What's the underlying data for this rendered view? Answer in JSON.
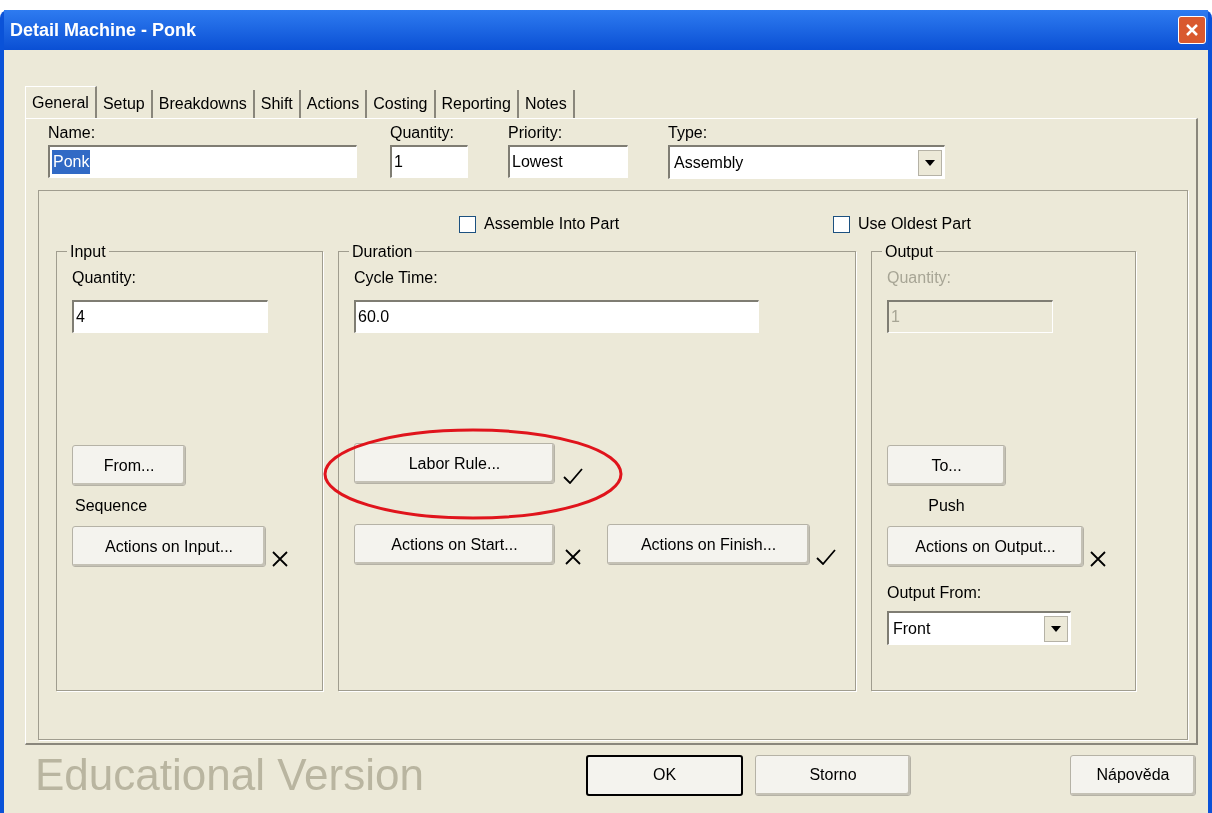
{
  "window": {
    "title": "Detail Machine - Ponk"
  },
  "tabs": [
    {
      "label": "General",
      "selected": true
    },
    {
      "label": "Setup",
      "selected": false
    },
    {
      "label": "Breakdowns",
      "selected": false
    },
    {
      "label": "Shift",
      "selected": false
    },
    {
      "label": "Actions",
      "selected": false
    },
    {
      "label": "Costing",
      "selected": false
    },
    {
      "label": "Reporting",
      "selected": false
    },
    {
      "label": "Notes",
      "selected": false
    }
  ],
  "name": {
    "label": "Name:",
    "value": "Ponk",
    "highlighted": true
  },
  "quantity": {
    "label": "Quantity:",
    "value": "1"
  },
  "priority": {
    "label": "Priority:",
    "value": "Lowest"
  },
  "type": {
    "label": "Type:",
    "value": "Assembly"
  },
  "checkboxes": [
    {
      "label": "Assemble Into Part",
      "checked": false
    },
    {
      "label": "Use Oldest Part",
      "checked": false
    }
  ],
  "input": {
    "title": "Input",
    "quantity_label": "Quantity:",
    "quantity": "4",
    "from_button": "From...",
    "mode": "Sequence",
    "actions_button": "Actions on Input...",
    "actions_set": false
  },
  "duration": {
    "title": "Duration",
    "cycle_label": "Cycle Time:",
    "cycle": "60.0",
    "labor_button": "Labor Rule...",
    "labor_set": true,
    "labor_circled": true,
    "start_button": "Actions on Start...",
    "start_set": false,
    "finish_button": "Actions on Finish...",
    "finish_set": true
  },
  "output": {
    "title": "Output",
    "quantity_label": "Quantity:",
    "quantity": "1",
    "quantity_disabled": true,
    "to_button": "To...",
    "mode": "Push",
    "actions_button": "Actions on Output...",
    "actions_set": false,
    "from_label": "Output From:",
    "from_value": "Front"
  },
  "background_text": "Educational Version",
  "buttons": [
    {
      "label": "OK",
      "default": true
    },
    {
      "label": "Storno",
      "default": false
    },
    {
      "label": "Nápověda",
      "default": false
    }
  ]
}
